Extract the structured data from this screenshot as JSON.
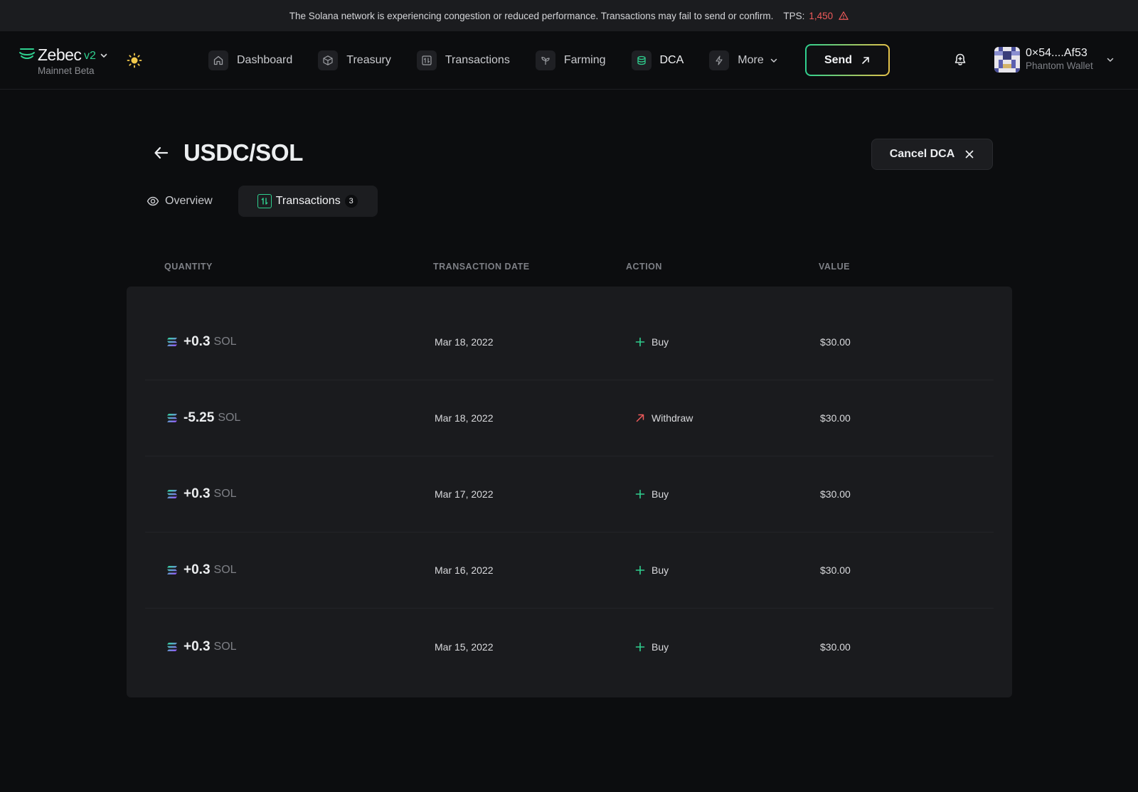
{
  "banner": {
    "message": "The Solana network is experiencing congestion or reduced performance. Transactions may fail to send or confirm.",
    "tps_label": "TPS:",
    "tps_value": "1,450"
  },
  "brand": {
    "name": "Zebec",
    "version": "v2",
    "network": "Mainnet Beta"
  },
  "nav": {
    "items": [
      {
        "label": "Dashboard",
        "icon": "home-icon"
      },
      {
        "label": "Treasury",
        "icon": "cube-icon"
      },
      {
        "label": "Transactions",
        "icon": "transfer-icon"
      },
      {
        "label": "Farming",
        "icon": "sprout-icon"
      },
      {
        "label": "DCA",
        "icon": "coins-icon",
        "active": true
      },
      {
        "label": "More",
        "icon": "bolt-icon"
      }
    ],
    "send_label": "Send"
  },
  "wallet": {
    "address": "0×54....Af53",
    "name": "Phantom Wallet"
  },
  "page": {
    "title": "USDC/SOL",
    "cancel_label": "Cancel DCA",
    "tabs": [
      {
        "label": "Overview"
      },
      {
        "label": "Transactions",
        "count": "3",
        "active": true
      }
    ]
  },
  "table": {
    "headers": [
      "QUANTITY",
      "TRANSACTION DATE",
      "ACTION",
      "VALUE"
    ],
    "rows": [
      {
        "qty": "+0.3",
        "unit": "SOL",
        "date": "Mar 18, 2022",
        "action": "Buy",
        "value": "$30.00"
      },
      {
        "qty": "-5.25",
        "unit": "SOL",
        "date": "Mar 18, 2022",
        "action": "Withdraw",
        "value": "$30.00"
      },
      {
        "qty": "+0.3",
        "unit": "SOL",
        "date": "Mar 17, 2022",
        "action": "Buy",
        "value": "$30.00"
      },
      {
        "qty": "+0.3",
        "unit": "SOL",
        "date": "Mar 16, 2022",
        "action": "Buy",
        "value": "$30.00"
      },
      {
        "qty": "+0.3",
        "unit": "SOL",
        "date": "Mar 15, 2022",
        "action": "Buy",
        "value": "$30.00"
      }
    ]
  },
  "colors": {
    "accent_green": "#2fd08f",
    "warning_red": "#ee5a5a",
    "withdraw_red": "#ef5b5b",
    "send_gradient_end": "#e4c24a"
  }
}
